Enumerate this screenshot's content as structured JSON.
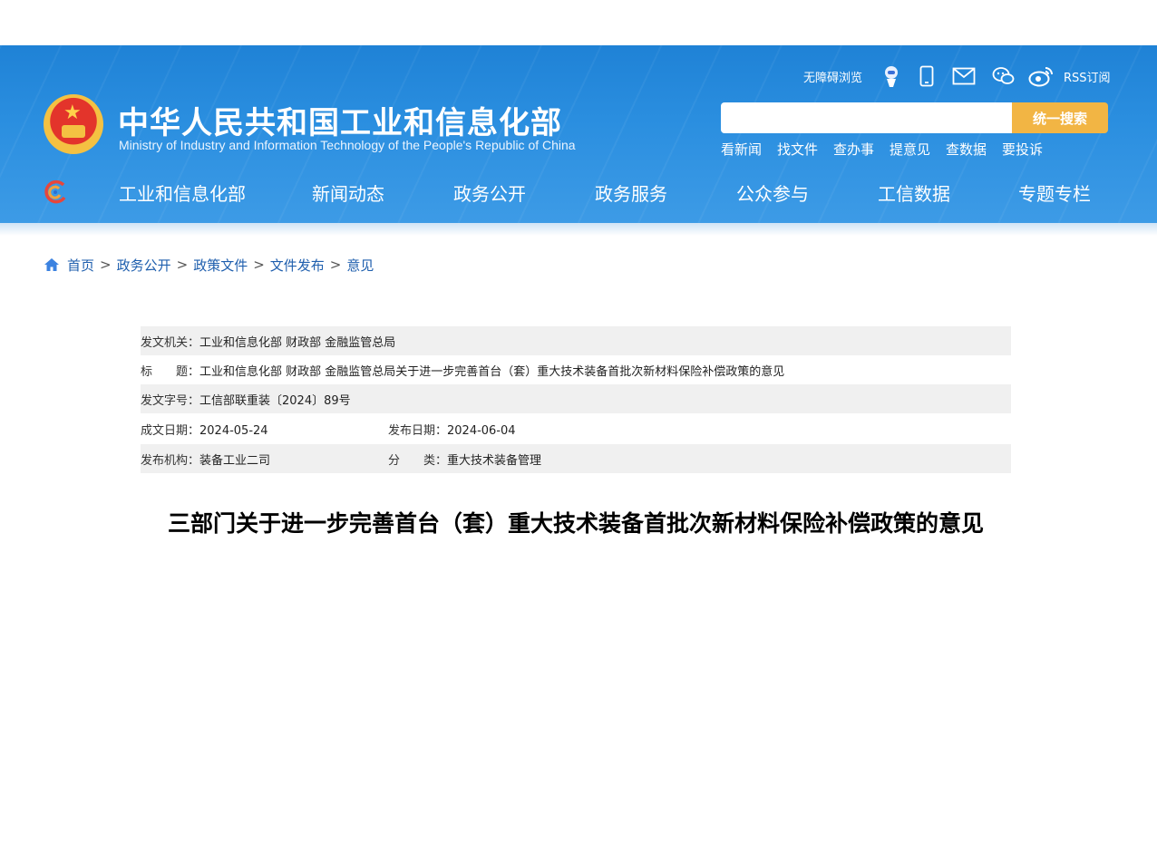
{
  "header": {
    "site_name_cn": "中华人民共和国工业和信息化部",
    "site_name_en": "Ministry of Industry and Information Technology of the People's Republic of China",
    "accessibility": "无障碍浏览",
    "rss": "RSS订阅",
    "utility_icons": [
      "robot-icon",
      "mobile-icon",
      "mail-icon",
      "wechat-icon",
      "weibo-icon"
    ],
    "search": {
      "placeholder": "",
      "button": "统一搜索"
    },
    "quick_links": [
      "看新闻",
      "找文件",
      "查办事",
      "提意见",
      "查数据",
      "要投诉"
    ]
  },
  "nav": {
    "items": [
      "工业和信息化部",
      "新闻动态",
      "政务公开",
      "政务服务",
      "公众参与",
      "工信数据",
      "专题专栏"
    ]
  },
  "breadcrumb": [
    "首页",
    "政务公开",
    "政策文件",
    "文件发布",
    "意见"
  ],
  "meta": {
    "issuer_label": "发文机关：",
    "issuer": "工业和信息化部 财政部 金融监管总局",
    "title_label": "标　　题：",
    "title": "工业和信息化部 财政部 金融监管总局关于进一步完善首台（套）重大技术装备首批次新材料保险补偿政策的意见",
    "doc_no_label": "发文字号：",
    "doc_no": "工信部联重装〔2024〕89号",
    "written_label": "成文日期：",
    "written": "2024-05-24",
    "published_label": "发布日期：",
    "published": "2024-06-04",
    "agency_label": "发布机构：",
    "agency": "装备工业二司",
    "category_label": "分　　类：",
    "category": "重大技术装备管理"
  },
  "document": {
    "title": "三部门关于进一步完善首台（套）重大技术装备首批次新材料保险补偿政策的意见"
  },
  "colors": {
    "header_blue": "#2b8fe0",
    "search_button": "#f2b544",
    "link_blue": "#1f5fae",
    "meta_gray": "#f0f0f0"
  }
}
